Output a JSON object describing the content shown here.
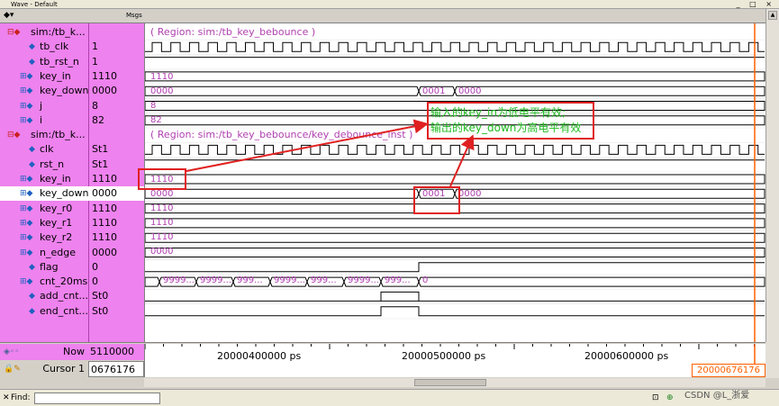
{
  "window": {
    "title": "Wave - Default",
    "controls": "_ □ ×"
  },
  "header": {
    "msgs_label": "Msgs"
  },
  "signals": [
    {
      "name": "sim:/tb_k...",
      "value": "",
      "indent": 0,
      "group": true
    },
    {
      "name": "tb_clk",
      "value": "1",
      "indent": 1
    },
    {
      "name": "tb_rst_n",
      "value": "1",
      "indent": 1
    },
    {
      "name": "key_in",
      "value": "1110",
      "indent": 1,
      "expand": true
    },
    {
      "name": "key_down",
      "value": "0000",
      "indent": 1,
      "expand": true
    },
    {
      "name": "j",
      "value": "8",
      "indent": 1,
      "expand": true
    },
    {
      "name": "i",
      "value": "82",
      "indent": 1,
      "expand": true
    },
    {
      "name": "sim:/tb_k...",
      "value": "",
      "indent": 0,
      "group": true
    },
    {
      "name": "clk",
      "value": "St1",
      "indent": 1
    },
    {
      "name": "rst_n",
      "value": "St1",
      "indent": 1
    },
    {
      "name": "key_in",
      "value": "1110",
      "indent": 1,
      "expand": true
    },
    {
      "name": "key_down",
      "value": "0000",
      "indent": 1,
      "expand": true,
      "selected": true
    },
    {
      "name": "key_r0",
      "value": "1110",
      "indent": 1,
      "expand": true
    },
    {
      "name": "key_r1",
      "value": "1110",
      "indent": 1,
      "expand": true
    },
    {
      "name": "key_r2",
      "value": "1110",
      "indent": 1,
      "expand": true
    },
    {
      "name": "n_edge",
      "value": "0000",
      "indent": 1,
      "expand": true
    },
    {
      "name": "flag",
      "value": "0",
      "indent": 1
    },
    {
      "name": "cnt_20ms",
      "value": "0",
      "indent": 1,
      "expand": true
    },
    {
      "name": "add_cnt...",
      "value": "St0",
      "indent": 1
    },
    {
      "name": "end_cnt...",
      "value": "St0",
      "indent": 1
    }
  ],
  "wave_labels": {
    "region1": "( Region: sim:/tb_key_bebounce )",
    "key_in_top": "1110",
    "key_down_top_a": "0000",
    "key_down_top_b": "0001",
    "key_down_top_c": "0000",
    "j_val": "8",
    "i_val": "82",
    "region2": "( Region: sim:/tb_key_bebounce/key_debounce_inst )",
    "key_in_inst": "1110",
    "key_down_inst_a": "0000",
    "key_down_inst_b": "0001",
    "key_down_inst_c": "0000",
    "key_r0": "1110",
    "key_r1": "1110",
    "key_r2": "1110",
    "n_edge": "0000",
    "cnt_seg1": "9999...",
    "cnt_seg2": "9999...",
    "cnt_seg3": "999...",
    "cnt_seg4": "9999...",
    "cnt_seg5": "999...",
    "cnt_seg6": "9999...",
    "cnt_seg7": "999...",
    "cnt_zero": "0"
  },
  "annotation": {
    "line1": "输入的key_in为低电平有效;",
    "line2": "输出的key_down为高电平有效"
  },
  "footer": {
    "now_label": "Now",
    "now_value": "5110000 ps",
    "cursor_label": "Cursor 1",
    "cursor_value": "0676176 ps",
    "tick1": "20000400000 ps",
    "tick2": "20000500000 ps",
    "tick3": "20000600000 ps",
    "cursor_time": "20000676176",
    "find_label": "Find:",
    "watermark": "CSDN @L_浙爱"
  },
  "colors": {
    "signal_bg": "#ee82ee",
    "annotation": "#e02020",
    "note_text": "#22bb22",
    "cursor": "#ff6000"
  }
}
